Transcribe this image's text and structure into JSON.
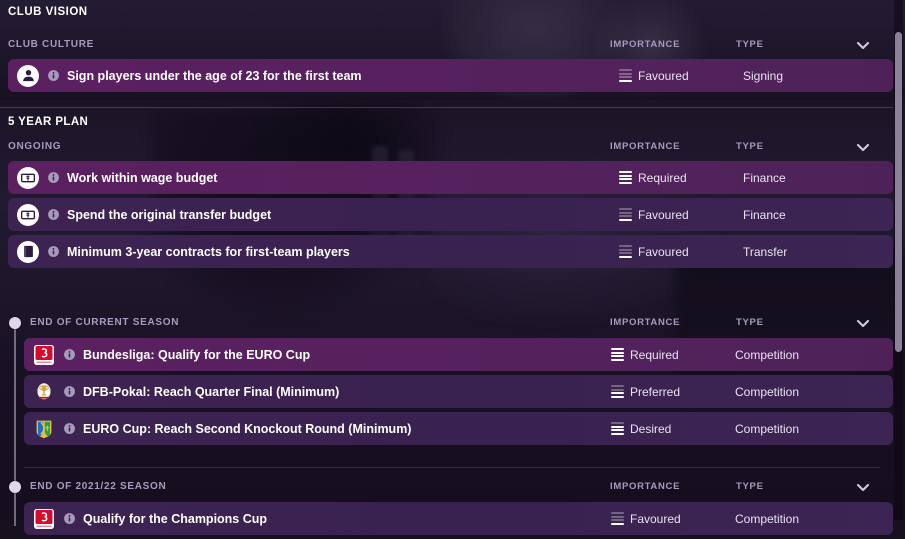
{
  "page": {
    "title": "CLUB VISION"
  },
  "columns": {
    "importance": "IMPORTANCE",
    "type": "TYPE"
  },
  "colors": {
    "row_bg": "#3a2250",
    "row_bg_highlight": "#56215e",
    "accent_text": "#a79bbd",
    "page_bg": "#16101f"
  },
  "sections": [
    {
      "title": "CLUB CULTURE",
      "group_label": "",
      "rows": [
        {
          "icon": "person-icon",
          "label": "Sign players under the age of 23 for the first team",
          "importance": "Favoured",
          "importance_level": 1,
          "type": "Signing",
          "highlight": true
        }
      ]
    },
    {
      "title": "5 YEAR PLAN",
      "group_label": "ONGOING",
      "rows": [
        {
          "icon": "banknote-icon",
          "label": "Work within wage budget",
          "importance": "Required",
          "importance_level": 4,
          "type": "Finance",
          "highlight": true
        },
        {
          "icon": "banknote-icon",
          "label": "Spend the original transfer budget",
          "importance": "Favoured",
          "importance_level": 1,
          "type": "Finance",
          "highlight": false
        },
        {
          "icon": "contract-icon",
          "label": "Minimum 3-year contracts for first-team players",
          "importance": "Favoured",
          "importance_level": 1,
          "type": "Transfer",
          "highlight": false
        }
      ]
    }
  ],
  "timeline": [
    {
      "group_label": "END OF CURRENT SEASON",
      "rows": [
        {
          "icon": "bundesliga-badge-icon",
          "label": "Bundesliga: Qualify for the EURO Cup",
          "importance": "Required",
          "importance_level": 4,
          "type": "Competition",
          "highlight": true
        },
        {
          "icon": "dfb-pokal-badge-icon",
          "label": "DFB-Pokal: Reach Quarter Final (Minimum)",
          "importance": "Preferred",
          "importance_level": 2,
          "type": "Competition",
          "highlight": false
        },
        {
          "icon": "euro-cup-badge-icon",
          "label": "EURO Cup: Reach Second Knockout Round (Minimum)",
          "importance": "Desired",
          "importance_level": 3,
          "type": "Competition",
          "highlight": false
        }
      ]
    },
    {
      "group_label": "END OF 2021/22 SEASON",
      "rows": [
        {
          "icon": "bundesliga-badge-icon",
          "label": "Qualify for the Champions Cup",
          "importance": "Favoured",
          "importance_level": 1,
          "type": "Competition",
          "highlight": false
        }
      ]
    }
  ]
}
